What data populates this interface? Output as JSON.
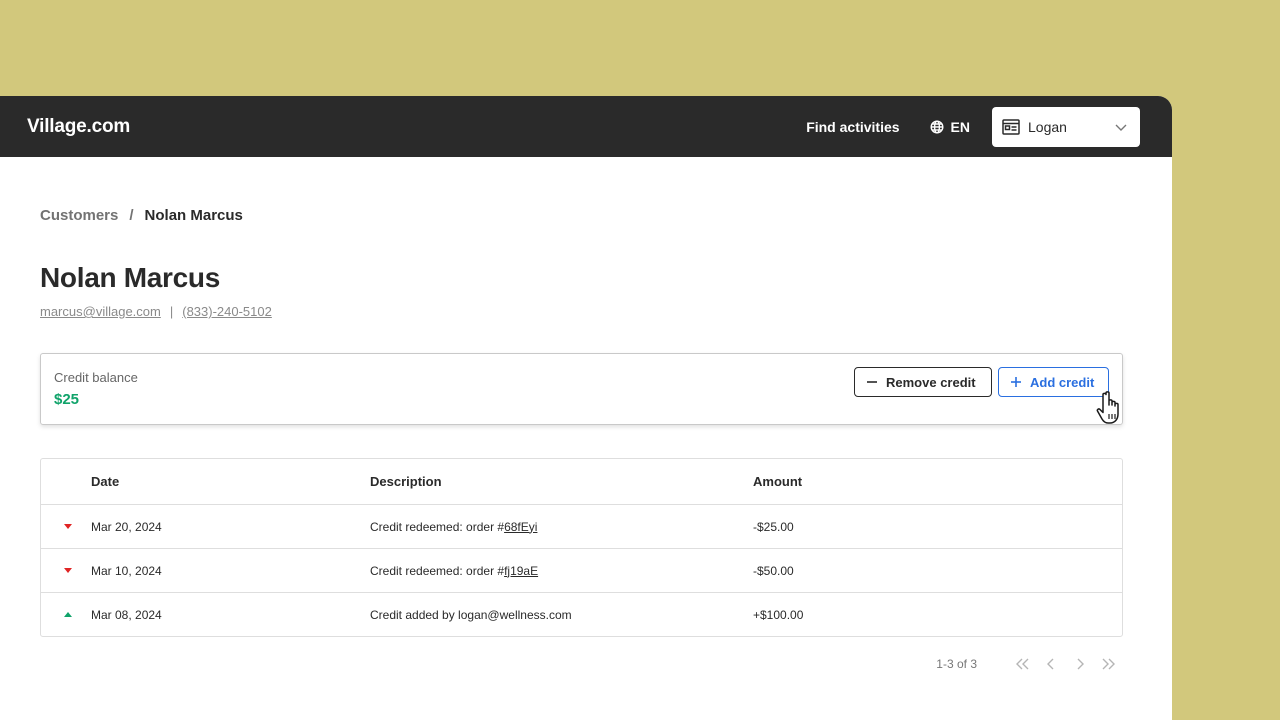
{
  "header": {
    "logo": "Village.com",
    "nav_find": "Find activities",
    "language": "EN",
    "account_name": "Logan"
  },
  "breadcrumb": {
    "parent": "Customers",
    "separator": "/",
    "current": "Nolan Marcus"
  },
  "customer": {
    "name": "Nolan Marcus",
    "email": "marcus@village.com",
    "divider": "|",
    "phone": "(833)-240-5102"
  },
  "credit": {
    "label": "Credit balance",
    "value": "$25",
    "remove_label": "Remove credit",
    "add_label": "Add credit"
  },
  "table": {
    "columns": [
      "Date",
      "Description",
      "Amount"
    ],
    "rows": [
      {
        "direction": "down",
        "date": "Mar 20, 2024",
        "desc_text": "Credit redeemed: order #",
        "desc_link": "68fEyi",
        "amount": "-$25.00"
      },
      {
        "direction": "down",
        "date": "Mar 10, 2024",
        "desc_text": "Credit redeemed: order #",
        "desc_link": "fj19aE",
        "amount": "-$50.00"
      },
      {
        "direction": "up",
        "date": "Mar 08, 2024",
        "desc_text": "Credit added by logan@wellness.com",
        "desc_link": "",
        "amount": "+$100.00"
      }
    ]
  },
  "pagination": {
    "info": "1-3 of 3"
  },
  "colors": {
    "background": "#d2c87c",
    "topbar": "#2a2a2a",
    "positive": "#10a36a",
    "negative": "#e02424",
    "accent": "#2a6fe0"
  },
  "icons": {
    "language": "globe-icon",
    "account": "id-card-icon",
    "account_dropdown": "chevron-down-icon",
    "remove": "minus-icon",
    "add": "plus-icon",
    "cursor": "hand-pointer-icon",
    "first_page": "double-chevron-left-icon",
    "prev_page": "chevron-left-icon",
    "next_page": "chevron-right-icon",
    "last_page": "double-chevron-right-icon"
  }
}
